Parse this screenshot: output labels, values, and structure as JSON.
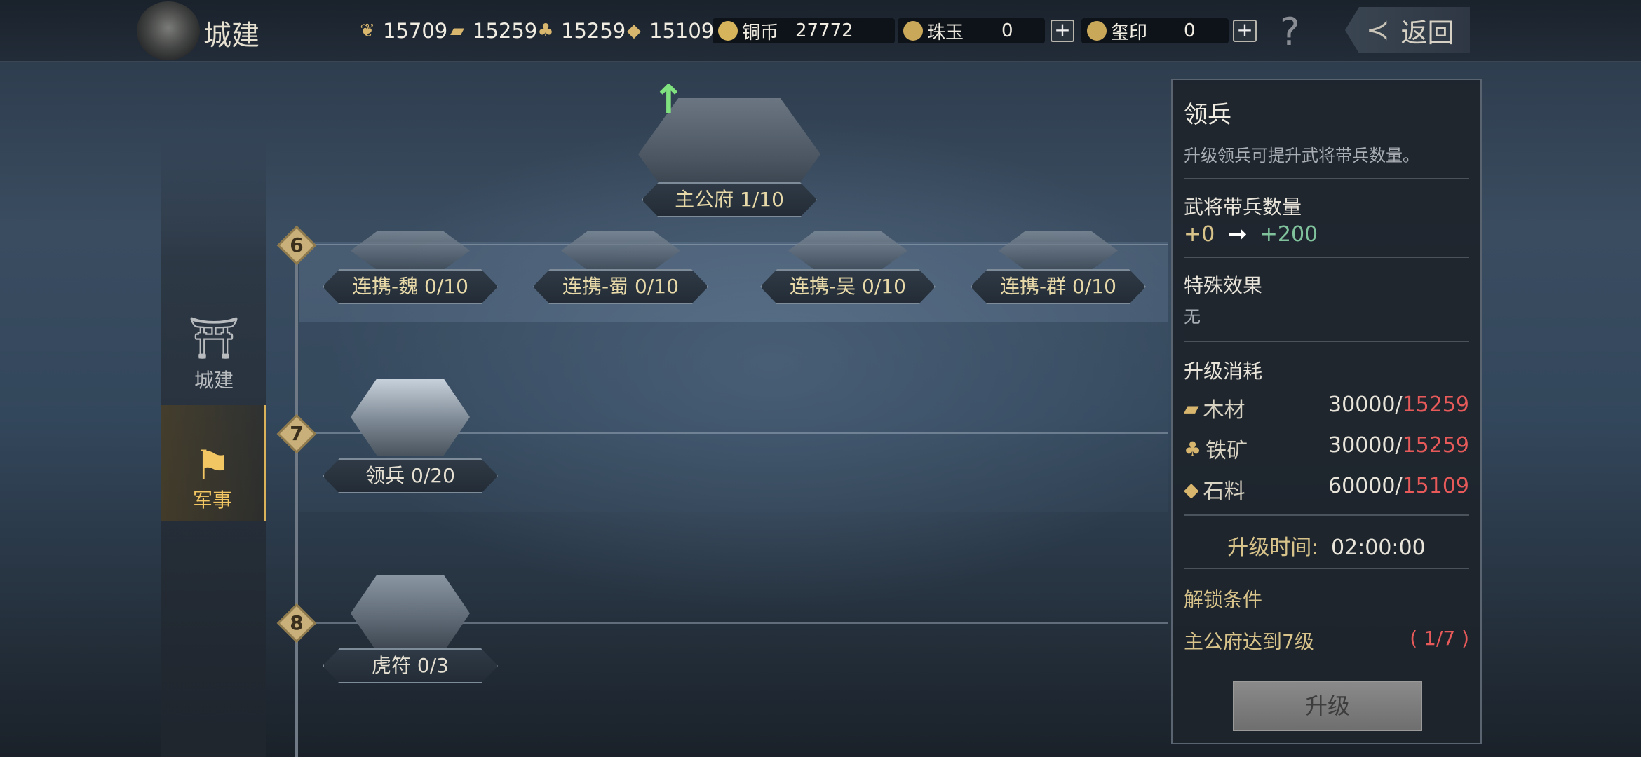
{
  "header": {
    "title": "城建",
    "resources": [
      {
        "name": "grain-icon",
        "value": "15709"
      },
      {
        "name": "wood-icon",
        "value": "15259"
      },
      {
        "name": "iron-icon",
        "value": "15259"
      },
      {
        "name": "stone-icon",
        "value": "15109"
      }
    ],
    "copper": {
      "label": "铜币",
      "value": "27772"
    },
    "jade": {
      "label": "珠玉",
      "value": "0"
    },
    "seal": {
      "label": "玺印",
      "value": "0"
    },
    "help": "?",
    "back": "返回"
  },
  "tabs": [
    {
      "label": "城建",
      "icon": "city-gate-icon",
      "active": false
    },
    {
      "label": "军事",
      "icon": "flag-icon",
      "active": true
    }
  ],
  "tree": {
    "top": {
      "label": "主公府 1/10"
    },
    "levels": [
      "6",
      "7",
      "8"
    ],
    "row6": [
      {
        "label": "连携-魏 0/10"
      },
      {
        "label": "连携-蜀 0/10"
      },
      {
        "label": "连携-吴 0/10"
      },
      {
        "label": "连携-群 0/10"
      }
    ],
    "row7": [
      {
        "label": "领兵 0/20"
      }
    ],
    "row8": [
      {
        "label": "虎符 0/3"
      }
    ]
  },
  "detail": {
    "title": "领兵",
    "desc": "升级领兵可提升武将带兵数量。",
    "stat_head": "武将带兵数量",
    "stat_from": "+0",
    "stat_to": "+200",
    "effect_head": "特殊效果",
    "effect_value": "无",
    "cost_head": "升级消耗",
    "costs": [
      {
        "name": "木材",
        "need": "30000/",
        "have": "15259"
      },
      {
        "name": "铁矿",
        "need": "30000/",
        "have": "15259"
      },
      {
        "name": "石料",
        "need": "60000/",
        "have": "15109"
      }
    ],
    "time_label": "升级时间:",
    "time_value": "02:00:00",
    "unlock_head": "解锁条件",
    "unlock_cond": "主公府达到7级",
    "unlock_progress": "( 1/7 )",
    "upgrade_button": "升级"
  },
  "colors": {
    "gold": "#f2c662",
    "red": "#e85a5a",
    "green": "#7fc29b"
  }
}
